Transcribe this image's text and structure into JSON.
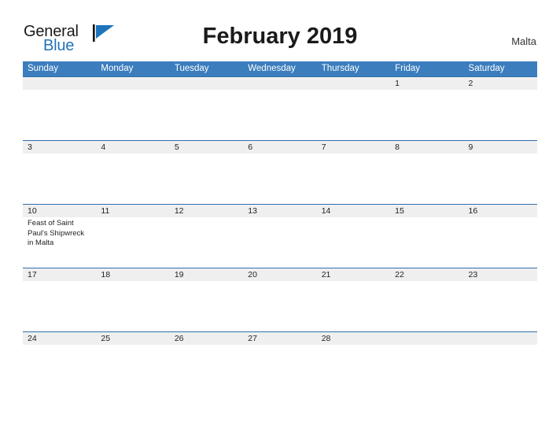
{
  "brand": {
    "name_part1": "General",
    "name_part2": "Blue",
    "mark_icon": "blue-flag-triangle-icon",
    "accent_color": "#2272b9"
  },
  "header": {
    "title": "February 2019",
    "locale": "Malta"
  },
  "calendar": {
    "header_color": "#3b7dbd",
    "date_band_color": "#efefef",
    "row_line_color": "#2f6fad",
    "weekdays": [
      "Sunday",
      "Monday",
      "Tuesday",
      "Wednesday",
      "Thursday",
      "Friday",
      "Saturday"
    ],
    "weeks": [
      {
        "days": [
          {
            "date": "",
            "event": ""
          },
          {
            "date": "",
            "event": ""
          },
          {
            "date": "",
            "event": ""
          },
          {
            "date": "",
            "event": ""
          },
          {
            "date": "",
            "event": ""
          },
          {
            "date": "1",
            "event": ""
          },
          {
            "date": "2",
            "event": ""
          }
        ]
      },
      {
        "days": [
          {
            "date": "3",
            "event": ""
          },
          {
            "date": "4",
            "event": ""
          },
          {
            "date": "5",
            "event": ""
          },
          {
            "date": "6",
            "event": ""
          },
          {
            "date": "7",
            "event": ""
          },
          {
            "date": "8",
            "event": ""
          },
          {
            "date": "9",
            "event": ""
          }
        ]
      },
      {
        "days": [
          {
            "date": "10",
            "event": "Feast of Saint Paul's Shipwreck in Malta"
          },
          {
            "date": "11",
            "event": ""
          },
          {
            "date": "12",
            "event": ""
          },
          {
            "date": "13",
            "event": ""
          },
          {
            "date": "14",
            "event": ""
          },
          {
            "date": "15",
            "event": ""
          },
          {
            "date": "16",
            "event": ""
          }
        ]
      },
      {
        "days": [
          {
            "date": "17",
            "event": ""
          },
          {
            "date": "18",
            "event": ""
          },
          {
            "date": "19",
            "event": ""
          },
          {
            "date": "20",
            "event": ""
          },
          {
            "date": "21",
            "event": ""
          },
          {
            "date": "22",
            "event": ""
          },
          {
            "date": "23",
            "event": ""
          }
        ]
      },
      {
        "days": [
          {
            "date": "24",
            "event": ""
          },
          {
            "date": "25",
            "event": ""
          },
          {
            "date": "26",
            "event": ""
          },
          {
            "date": "27",
            "event": ""
          },
          {
            "date": "28",
            "event": ""
          },
          {
            "date": "",
            "event": ""
          },
          {
            "date": "",
            "event": ""
          }
        ]
      }
    ]
  }
}
